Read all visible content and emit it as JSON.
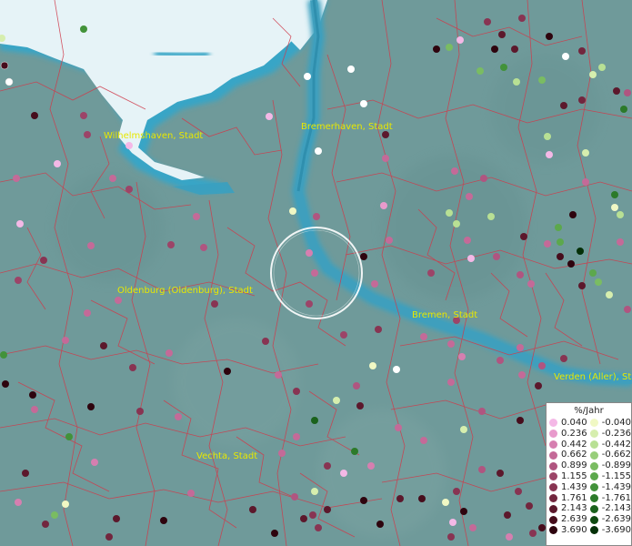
{
  "cities": [
    {
      "name": "Wilhelmshaven, Stadt"
    },
    {
      "name": "Bremerhaven, Stadt"
    },
    {
      "name": "Oldenburg (Oldenburg), Stadt"
    },
    {
      "name": "Bremen, Stadt"
    },
    {
      "name": "Verden (Aller), Stadt"
    },
    {
      "name": "Vechta, Stadt"
    }
  ],
  "legend": {
    "title": "%/Jahr",
    "positive": [
      {
        "label": "0.040",
        "color": "#f4b8e6"
      },
      {
        "label": "0.236",
        "color": "#e89acc"
      },
      {
        "label": "0.442",
        "color": "#d67fb0"
      },
      {
        "label": "0.662",
        "color": "#c46a98"
      },
      {
        "label": "0.899",
        "color": "#b05580"
      },
      {
        "label": "1.155",
        "color": "#9c4468"
      },
      {
        "label": "1.439",
        "color": "#883452"
      },
      {
        "label": "1.761",
        "color": "#72263e"
      },
      {
        "label": "2.143",
        "color": "#5c182c"
      },
      {
        "label": "2.639",
        "color": "#460d1c"
      },
      {
        "label": "3.690",
        "color": "#2e040e"
      }
    ],
    "negative": [
      {
        "label": "-0.040",
        "color": "#f0f8c4"
      },
      {
        "label": "-0.236",
        "color": "#d6eeae"
      },
      {
        "label": "-0.442",
        "color": "#b8e094"
      },
      {
        "label": "-0.662",
        "color": "#98ce7a"
      },
      {
        "label": "-0.899",
        "color": "#7abc62"
      },
      {
        "label": "-1.155",
        "color": "#5ca84c"
      },
      {
        "label": "-1.439",
        "color": "#42923a"
      },
      {
        "label": "-1.761",
        "color": "#2c7a2a"
      },
      {
        "label": "-2.143",
        "color": "#1a621c"
      },
      {
        "label": "-2.639",
        "color": "#0e4a10"
      },
      {
        "label": "-3.690",
        "color": "#043008"
      }
    ]
  },
  "colors": {
    "land": "#6f9a9a",
    "water": "#3aa0c0",
    "sea": "#e8f4f8",
    "border": "#d03a4a",
    "label": "#e8e800"
  },
  "icons": [
    "crosshair-circle-icon",
    "measurement-point-icon"
  ]
}
